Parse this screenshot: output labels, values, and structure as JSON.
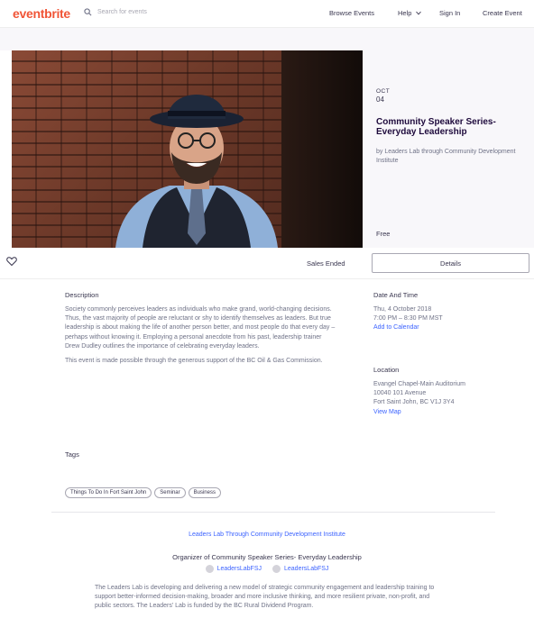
{
  "header": {
    "logo": "eventbrite",
    "search_placeholder": "Search for events",
    "nav": {
      "browse": "Browse Events",
      "help": "Help",
      "sign_in": "Sign In",
      "create": "Create Event"
    }
  },
  "event": {
    "month": "OCT",
    "day": "04",
    "title": "Community Speaker Series- Everyday Leadership",
    "by": "by Leaders Lab through Community Development Institute",
    "price": "Free",
    "sales_status": "Sales Ended",
    "details_button": "Details"
  },
  "description": {
    "heading": "Description",
    "p1": "Society commonly perceives leaders as individuals who make grand, world-changing decisions. Thus, the vast majority of people are reluctant or shy to identify themselves as leaders. But true leadership is about making the life of another person better, and most people do that every day – perhaps without knowing it. Employing a personal anecdote from his past, leadership trainer Drew Dudley outlines the importance of celebrating everyday leaders.",
    "p2": "This event is made possible through the generous support of the BC Oil & Gas Commission."
  },
  "datetime": {
    "heading": "Date And Time",
    "date": "Thu, 4 October 2018",
    "time": "7:00 PM – 8:30 PM MST",
    "add_calendar": "Add to Calendar"
  },
  "location": {
    "heading": "Location",
    "venue": "Evangel Chapel-Main Auditorium",
    "street": "10040 101 Avenue",
    "city": "Fort Saint John, BC V1J 3Y4",
    "view_map": "View Map"
  },
  "tags": {
    "heading": "Tags",
    "items": [
      "Things To Do In Fort Saint John",
      "Seminar",
      "Business"
    ]
  },
  "organizer": {
    "name": "Leaders Lab Through Community Development Institute",
    "organizer_of": "Organizer of Community Speaker Series- Everyday Leadership",
    "facebook": "LeadersLabFSJ",
    "twitter": "LeadersLabFSJ",
    "description": "The Leaders Lab is developing and delivering a new model of strategic community engagement and leadership training to support better-informed decision-making, broader and more inclusive thinking, and more resilient private, non-profit, and public sectors. The Leaders' Lab is funded by the BC Rural Dividend Program."
  },
  "colors": {
    "brand": "#f05537",
    "link": "#3d64ff",
    "title": "#1e0a3c"
  }
}
